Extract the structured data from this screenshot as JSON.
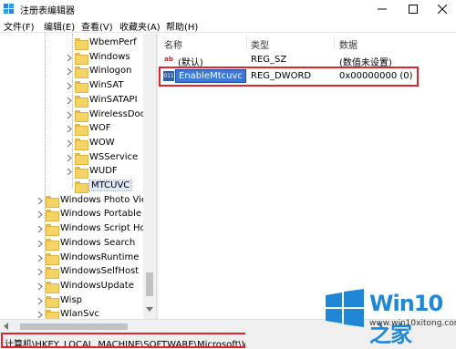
{
  "window": {
    "title": "注册表编辑器"
  },
  "menu": [
    "文件(F)",
    "编辑(E)",
    "查看(V)",
    "收藏夹(A)",
    "帮助(H)"
  ],
  "tree": [
    {
      "label": "WbemPerf",
      "indent": 1,
      "expander": false
    },
    {
      "label": "Windows",
      "indent": 1,
      "expander": true
    },
    {
      "label": "Winlogon",
      "indent": 1,
      "expander": true
    },
    {
      "label": "WinSAT",
      "indent": 1,
      "expander": true
    },
    {
      "label": "WinSATAPI",
      "indent": 1,
      "expander": true
    },
    {
      "label": "WirelessDoc",
      "indent": 1,
      "expander": true
    },
    {
      "label": "WOF",
      "indent": 1,
      "expander": true
    },
    {
      "label": "WOW",
      "indent": 1,
      "expander": true
    },
    {
      "label": "WSService",
      "indent": 1,
      "expander": true
    },
    {
      "label": "WUDF",
      "indent": 1,
      "expander": true
    },
    {
      "label": "MTCUVC",
      "indent": 1,
      "expander": false,
      "selected": true
    },
    {
      "label": "Windows Photo Vie",
      "indent": 0,
      "expander": true
    },
    {
      "label": "Windows Portable",
      "indent": 0,
      "expander": true
    },
    {
      "label": "Windows Script Ho",
      "indent": 0,
      "expander": true
    },
    {
      "label": "Windows Search",
      "indent": 0,
      "expander": true
    },
    {
      "label": "WindowsRuntime",
      "indent": 0,
      "expander": true
    },
    {
      "label": "WindowsSelfHost",
      "indent": 0,
      "expander": true
    },
    {
      "label": "WindowsUpdate",
      "indent": 0,
      "expander": true
    },
    {
      "label": "Wisp",
      "indent": 0,
      "expander": true
    },
    {
      "label": "WlanSvc",
      "indent": 0,
      "expander": true
    }
  ],
  "list": {
    "columns": {
      "name": "名称",
      "type": "类型",
      "data": "数据"
    },
    "rows": [
      {
        "name": "(默认)",
        "type": "REG_SZ",
        "data": "(数值未设置)",
        "icon": "string-value-icon"
      },
      {
        "name": "EnableMtcuvc",
        "type": "REG_DWORD",
        "data": "0x00000000 (0)",
        "icon": "dword-value-icon",
        "editing": true
      }
    ]
  },
  "status": {
    "path": "计算机\\HKEY_LOCAL_MACHINE\\SOFTWARE\\Microsoft\\Wi"
  },
  "watermark": {
    "brand": "Win10 之家",
    "url": "www.win10xitong.com"
  },
  "colors": {
    "highlight": "#e0232d",
    "selection": "#3c78d8",
    "folder": "#f6d365",
    "brand": "#1f87d6"
  }
}
